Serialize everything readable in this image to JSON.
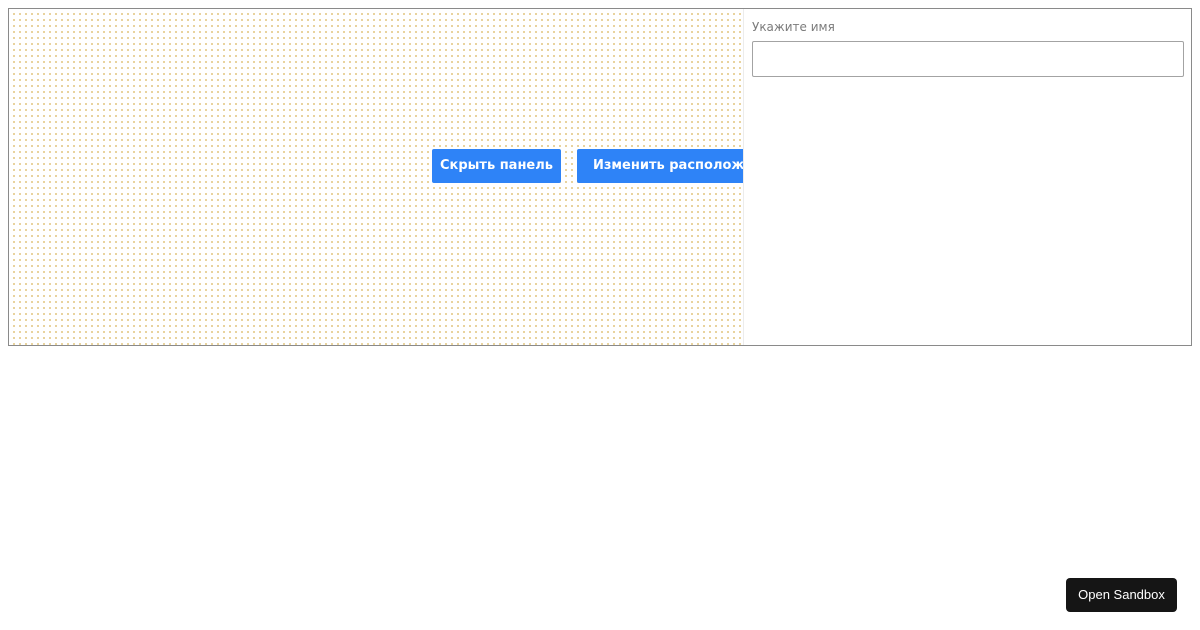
{
  "canvas": {
    "hide_panel_label": "Скрыть панель",
    "change_layout_label": "Изменить расположение"
  },
  "panel": {
    "name_label": "Укажите имя",
    "name_value": "",
    "name_placeholder": ""
  },
  "footer": {
    "open_sandbox_label": "Open Sandbox"
  },
  "colors": {
    "accent_button": "#2e83f7",
    "dot_grid": "#e3c886",
    "sandbox_button_bg": "#151515",
    "frame_border": "#8a8a8a"
  }
}
